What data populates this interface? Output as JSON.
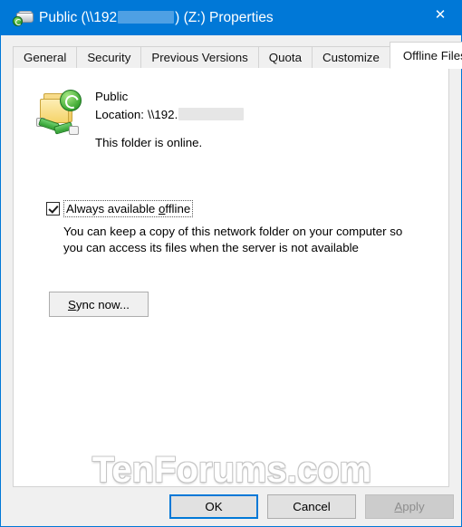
{
  "window": {
    "title_prefix": "Public (\\\\192",
    "title_suffix": ") (Z:) Properties",
    "icon": "network-drive-sync-icon",
    "close_label": "✕",
    "accent_color": "#0078d7",
    "titlebar_redaction_color": "#4ea0e4"
  },
  "tabs": [
    {
      "label": "General",
      "active": false
    },
    {
      "label": "Security",
      "active": false
    },
    {
      "label": "Previous Versions",
      "active": false
    },
    {
      "label": "Quota",
      "active": false
    },
    {
      "label": "Customize",
      "active": false
    },
    {
      "label": "Offline Files",
      "active": true
    }
  ],
  "offline_files": {
    "icon": "offline-folder-sync-icon",
    "folder_name": "Public",
    "location_label": "Location:",
    "location_value": "\\\\192.",
    "location_redaction_color": "#e6e6e6",
    "status_text": "This folder is online.",
    "checkbox": {
      "checked": true,
      "label_before_accel": "Always available ",
      "label_accel": "o",
      "label_after_accel": "ffline"
    },
    "description_line1": "You can keep a copy of this network folder on your computer so",
    "description_line2": "you can access its files when the server is not available",
    "sync_button": {
      "accel": "S",
      "rest": "ync now..."
    }
  },
  "watermark": "TenForums.com",
  "footer": {
    "ok_label": "OK",
    "cancel_label": "Cancel",
    "apply_accel": "A",
    "apply_rest": "pply",
    "apply_disabled": true
  }
}
